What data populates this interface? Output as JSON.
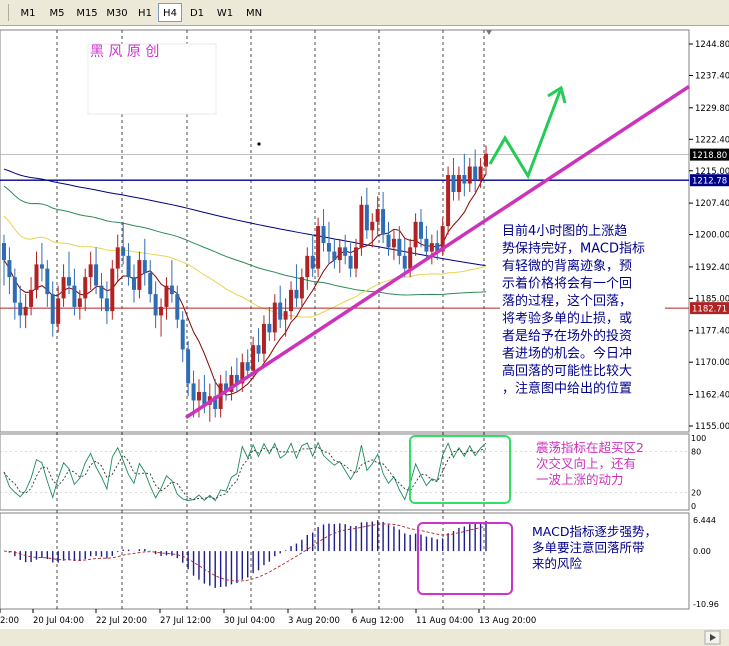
{
  "toolbar": {
    "timeframes": [
      "M1",
      "M5",
      "M15",
      "M30",
      "H1",
      "H4",
      "D1",
      "W1",
      "MN"
    ],
    "active": "H4"
  },
  "watermark": "黑 风 原 创",
  "annotations": {
    "main": [
      "目前4小时图的上涨趋",
      "势保持完好，MACD指标",
      "有轻微的背离迹象，预",
      "示着价格将会有一个回",
      "落的过程，这个回落，",
      "将考验多单的止损，或",
      "者是给予在场外的投资",
      "者进场的机会。今日冲",
      "高回落的可能性比较大",
      "，注意图中给出的位置"
    ],
    "stochastic": [
      "震荡指标在超买区2",
      "次交叉向上，还有",
      "一波上涨的动力"
    ],
    "macd": [
      "MACD指标逐步强势，",
      "多单要注意回落所带",
      "来的风险"
    ]
  },
  "colors": {
    "bull_candle": "#b22222",
    "bear_candle": "#2e6db4",
    "trendline": "#cc33bb",
    "forecast_arrow": "#22cc55",
    "resistance_line": "#00008b",
    "support_line": "#b22222",
    "stoch_box": "#33dd66",
    "macd_box": "#cc33cc",
    "text_annotation": "#00008b",
    "text_annotation_pink": "#cc33bb",
    "ma_slow": "#000080",
    "ma_mid": "#2e8b57",
    "ma_yellow": "#e8d44d",
    "ma_fast": "#8b0000"
  },
  "chart_data": [
    {
      "type": "candlestick",
      "panel": "price",
      "y_ticks": [
        "1244.80",
        "1237.40",
        "1229.80",
        "1222.40",
        "1215.00",
        "1207.40",
        "1200.00",
        "1192.40",
        "1185.00",
        "1177.40",
        "1170.00",
        "1162.40",
        "1155.00"
      ],
      "ylim": [
        1152,
        1248
      ],
      "price_labels": [
        {
          "value": 1218.8,
          "text": "1218.80"
        },
        {
          "value": 1212.78,
          "text": "1212.78"
        },
        {
          "value": 1182.71,
          "text": "1182.71"
        }
      ],
      "horizontal_lines": [
        {
          "value": 1212.78,
          "label": "resistance"
        },
        {
          "value": 1182.71,
          "label": "support"
        }
      ],
      "trendline": {
        "from": [
          186,
          1157
        ],
        "to": [
          729,
          1241
        ]
      },
      "candles_ohlc": [
        [
          1198,
          1200,
          1188,
          1194
        ],
        [
          1194,
          1197,
          1186,
          1190
        ],
        [
          1190,
          1192,
          1180,
          1184
        ],
        [
          1184,
          1188,
          1178,
          1181
        ],
        [
          1181,
          1186,
          1178,
          1183
        ],
        [
          1183,
          1190,
          1181,
          1187
        ],
        [
          1187,
          1196,
          1185,
          1193
        ],
        [
          1193,
          1198,
          1189,
          1192
        ],
        [
          1192,
          1194,
          1183,
          1186
        ],
        [
          1186,
          1189,
          1176,
          1179
        ],
        [
          1179,
          1188,
          1177,
          1185
        ],
        [
          1185,
          1193,
          1183,
          1190
        ],
        [
          1190,
          1196,
          1186,
          1188
        ],
        [
          1188,
          1192,
          1181,
          1183
        ],
        [
          1183,
          1187,
          1180,
          1185
        ],
        [
          1185,
          1192,
          1182,
          1190
        ],
        [
          1190,
          1196,
          1187,
          1193
        ],
        [
          1193,
          1197,
          1186,
          1188
        ],
        [
          1188,
          1191,
          1182,
          1185
        ],
        [
          1185,
          1189,
          1179,
          1182
        ],
        [
          1182,
          1194,
          1180,
          1192
        ],
        [
          1192,
          1200,
          1189,
          1197
        ],
        [
          1197,
          1203,
          1193,
          1195
        ],
        [
          1195,
          1198,
          1188,
          1190
        ],
        [
          1190,
          1193,
          1184,
          1187
        ],
        [
          1187,
          1196,
          1185,
          1194
        ],
        [
          1194,
          1199,
          1188,
          1191
        ],
        [
          1191,
          1194,
          1184,
          1186
        ],
        [
          1186,
          1189,
          1178,
          1181
        ],
        [
          1181,
          1185,
          1176,
          1183
        ],
        [
          1183,
          1190,
          1180,
          1188
        ],
        [
          1188,
          1194,
          1184,
          1186
        ],
        [
          1186,
          1188,
          1178,
          1180
        ],
        [
          1180,
          1182,
          1170,
          1173
        ],
        [
          1173,
          1175,
          1162,
          1165
        ],
        [
          1165,
          1168,
          1157,
          1161
        ],
        [
          1161,
          1166,
          1157,
          1163
        ],
        [
          1163,
          1167,
          1158,
          1160
        ],
        [
          1160,
          1165,
          1156,
          1162
        ],
        [
          1162,
          1166,
          1157,
          1159
        ],
        [
          1159,
          1167,
          1157,
          1165
        ],
        [
          1165,
          1168,
          1161,
          1163
        ],
        [
          1163,
          1169,
          1161,
          1167
        ],
        [
          1167,
          1171,
          1163,
          1165
        ],
        [
          1165,
          1172,
          1163,
          1170
        ],
        [
          1170,
          1173,
          1166,
          1168
        ],
        [
          1168,
          1176,
          1166,
          1174
        ],
        [
          1174,
          1178,
          1170,
          1172
        ],
        [
          1172,
          1181,
          1170,
          1179
        ],
        [
          1179,
          1183,
          1175,
          1177
        ],
        [
          1177,
          1186,
          1175,
          1184
        ],
        [
          1184,
          1188,
          1178,
          1180
        ],
        [
          1180,
          1185,
          1176,
          1182
        ],
        [
          1182,
          1189,
          1180,
          1187
        ],
        [
          1187,
          1193,
          1183,
          1185
        ],
        [
          1185,
          1192,
          1183,
          1190
        ],
        [
          1190,
          1197,
          1187,
          1195
        ],
        [
          1195,
          1200,
          1190,
          1192
        ],
        [
          1192,
          1204,
          1190,
          1202
        ],
        [
          1202,
          1206,
          1196,
          1198
        ],
        [
          1198,
          1203,
          1193,
          1196
        ],
        [
          1196,
          1199,
          1192,
          1194
        ],
        [
          1194,
          1199,
          1191,
          1197
        ],
        [
          1197,
          1200,
          1193,
          1195
        ],
        [
          1195,
          1198,
          1190,
          1192
        ],
        [
          1192,
          1199,
          1190,
          1197
        ],
        [
          1197,
          1209,
          1195,
          1207
        ],
        [
          1207,
          1211,
          1199,
          1201
        ],
        [
          1201,
          1205,
          1197,
          1203
        ],
        [
          1203,
          1209,
          1200,
          1206
        ],
        [
          1206,
          1210,
          1198,
          1200
        ],
        [
          1200,
          1203,
          1195,
          1197
        ],
        [
          1197,
          1201,
          1194,
          1199
        ],
        [
          1199,
          1202,
          1193,
          1195
        ],
        [
          1195,
          1199,
          1190,
          1192
        ],
        [
          1192,
          1199,
          1190,
          1197
        ],
        [
          1197,
          1205,
          1195,
          1203
        ],
        [
          1203,
          1206,
          1197,
          1199
        ],
        [
          1199,
          1202,
          1194,
          1196
        ],
        [
          1196,
          1200,
          1193,
          1198
        ],
        [
          1198,
          1201,
          1194,
          1196
        ],
        [
          1196,
          1204,
          1195,
          1202
        ],
        [
          1202,
          1216,
          1200,
          1214
        ],
        [
          1214,
          1218,
          1208,
          1210
        ],
        [
          1210,
          1216,
          1208,
          1214
        ],
        [
          1214,
          1219,
          1209,
          1212
        ],
        [
          1212,
          1218,
          1210,
          1216
        ],
        [
          1216,
          1220,
          1210,
          1213
        ],
        [
          1213,
          1218,
          1211,
          1216
        ],
        [
          1216,
          1221,
          1214,
          1219
        ]
      ]
    },
    {
      "type": "line",
      "panel": "stochastic",
      "y_ticks": [
        "100",
        "80",
        "20",
        "0"
      ],
      "ylim": [
        0,
        100
      ]
    },
    {
      "type": "bar",
      "panel": "macd",
      "y_ticks": [
        "6.444",
        "0.00",
        "-10.96"
      ],
      "ylim": [
        -10.96,
        6.444
      ]
    }
  ],
  "x_axis": {
    "tick_labels": [
      "2:00",
      "20 Jul 04:00",
      "22 Jul 20:00",
      "27 Jul 12:00",
      "30 Jul 04:00",
      "3 Aug 20:00",
      "6 Aug 12:00",
      "11 Aug 04:00",
      "13 Aug 20:00"
    ]
  }
}
